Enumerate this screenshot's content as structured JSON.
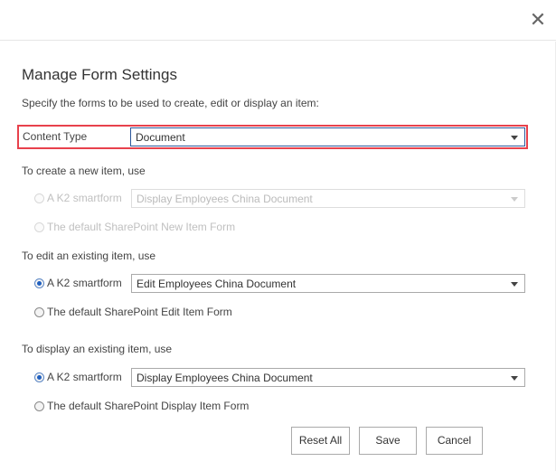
{
  "dialog": {
    "close_glyph": "✕",
    "title": "Manage Form Settings",
    "subtitle": "Specify the forms to be used to create, edit or display an item:"
  },
  "content_type": {
    "label": "Content Type",
    "value": "Document"
  },
  "create": {
    "heading": "To create a new item, use",
    "option_smartform": "A K2 smartform",
    "smartform_value": "Display Employees China Document",
    "option_default": "The default SharePoint New Item Form",
    "selected": "smartform",
    "disabled": true
  },
  "edit": {
    "heading": "To edit an existing item, use",
    "option_smartform": "A K2 smartform",
    "smartform_value": "Edit Employees China Document",
    "option_default": "The default SharePoint Edit Item Form",
    "selected": "smartform"
  },
  "display": {
    "heading": "To display an existing item, use",
    "option_smartform": "A K2 smartform",
    "smartform_value": "Display Employees China Document",
    "option_default": "The default SharePoint Display Item Form",
    "selected": "smartform"
  },
  "buttons": {
    "reset_all": "Reset All",
    "save": "Save",
    "cancel": "Cancel"
  },
  "colors": {
    "highlight_frame": "#e8414c",
    "radio_selected": "#1f5fbf"
  }
}
